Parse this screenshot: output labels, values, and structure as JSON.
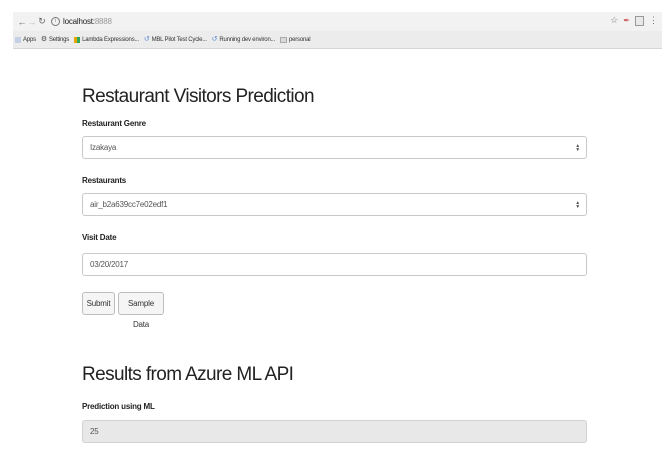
{
  "browser": {
    "url_host": "localhost:",
    "url_port": "8888",
    "bookmarks": [
      {
        "label": "Apps",
        "icon": "apps-grid-icon"
      },
      {
        "label": "Settings",
        "icon": "gear-icon"
      },
      {
        "label": "Lambda Expressions...",
        "icon": "lambda-favicon-icon"
      },
      {
        "label": "MBL Pilot Test Cycle...",
        "icon": "loading-spinner-icon"
      },
      {
        "label": "Running dev environ...",
        "icon": "loading-spinner-icon"
      },
      {
        "label": "personal",
        "icon": "folder-icon"
      }
    ]
  },
  "page": {
    "title": "Restaurant Visitors Prediction",
    "form": {
      "genre_label": "Restaurant Genre",
      "genre_value": "Izakaya",
      "restaurant_label": "Restaurants",
      "restaurant_value": "air_b2a639cc7e02edf1",
      "date_label": "Visit Date",
      "date_value": "03/20/2017",
      "submit_label": "Submit",
      "sample_label": "Sample Data"
    },
    "results": {
      "title": "Results from Azure ML API",
      "prediction_label": "Prediction using ML",
      "prediction_value": "25"
    }
  }
}
